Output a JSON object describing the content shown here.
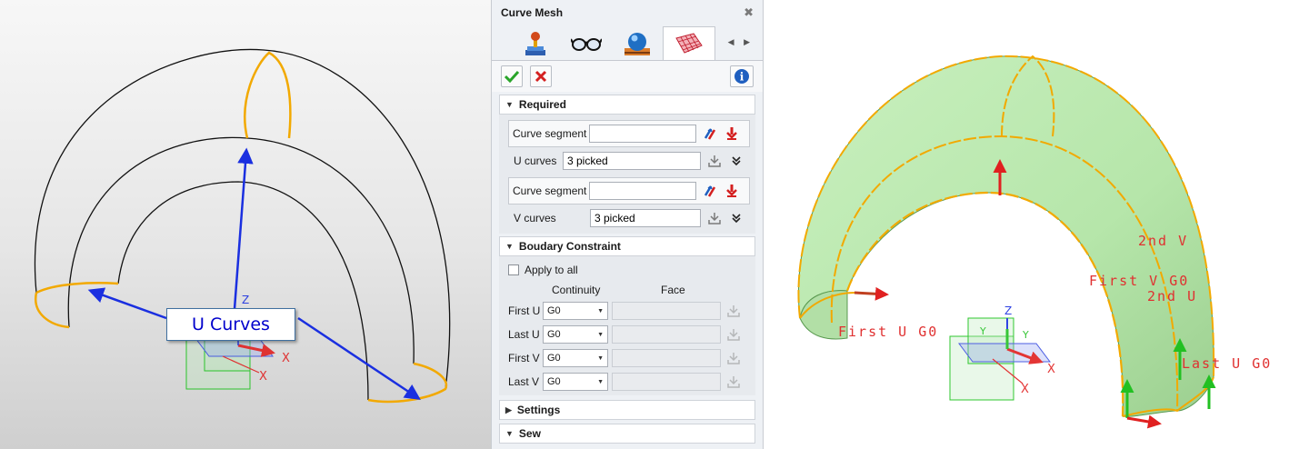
{
  "left_view": {
    "callout": "U Curves",
    "triad": {
      "z": "Z",
      "x1": "X",
      "x2": "X"
    }
  },
  "panel": {
    "title": "Curve Mesh",
    "close_glyph": "✖",
    "tabs": [
      {
        "name": "joystick-tab-icon"
      },
      {
        "name": "glasses-tab-icon"
      },
      {
        "name": "sphere-tab-icon"
      },
      {
        "name": "surface-mesh-tab-icon",
        "active": true
      }
    ],
    "tab_scroll": "◀ ▶",
    "confirm_icon": "check-icon",
    "cancel_icon": "x-icon",
    "info_glyph": "i",
    "required": {
      "header": "Required",
      "u_segment_label": "Curve segment",
      "u_segment_value": "",
      "u_curves_label": "U curves",
      "u_curves_value": "3 picked",
      "v_segment_label": "Curve segment",
      "v_segment_value": "",
      "v_curves_label": "V curves",
      "v_curves_value": "3 picked"
    },
    "boundary": {
      "header": "Boudary Constraint",
      "apply_all": "Apply to all",
      "continuity_header": "Continuity",
      "face_header": "Face",
      "rows": [
        {
          "label": "First U",
          "value": "G0"
        },
        {
          "label": "Last U",
          "value": "G0"
        },
        {
          "label": "First V",
          "value": "G0"
        },
        {
          "label": "Last V",
          "value": "G0"
        }
      ]
    },
    "settings": {
      "header": "Settings"
    },
    "sew": {
      "header": "Sew"
    }
  },
  "right_view": {
    "labels": {
      "first_u": "First U G0",
      "second_v": "2nd V",
      "first_v": "First V G0",
      "second_u": "2nd U",
      "last_u": "Last U G0"
    },
    "triad": {
      "z": "Z",
      "y1": "Y",
      "y2": "Y",
      "x1": "X",
      "x2": "X"
    }
  },
  "colors": {
    "accent_curve": "#f2a900",
    "annotation": "#e03030",
    "surface": "#c4efb8",
    "arrow_blue": "#1a2fe0"
  }
}
